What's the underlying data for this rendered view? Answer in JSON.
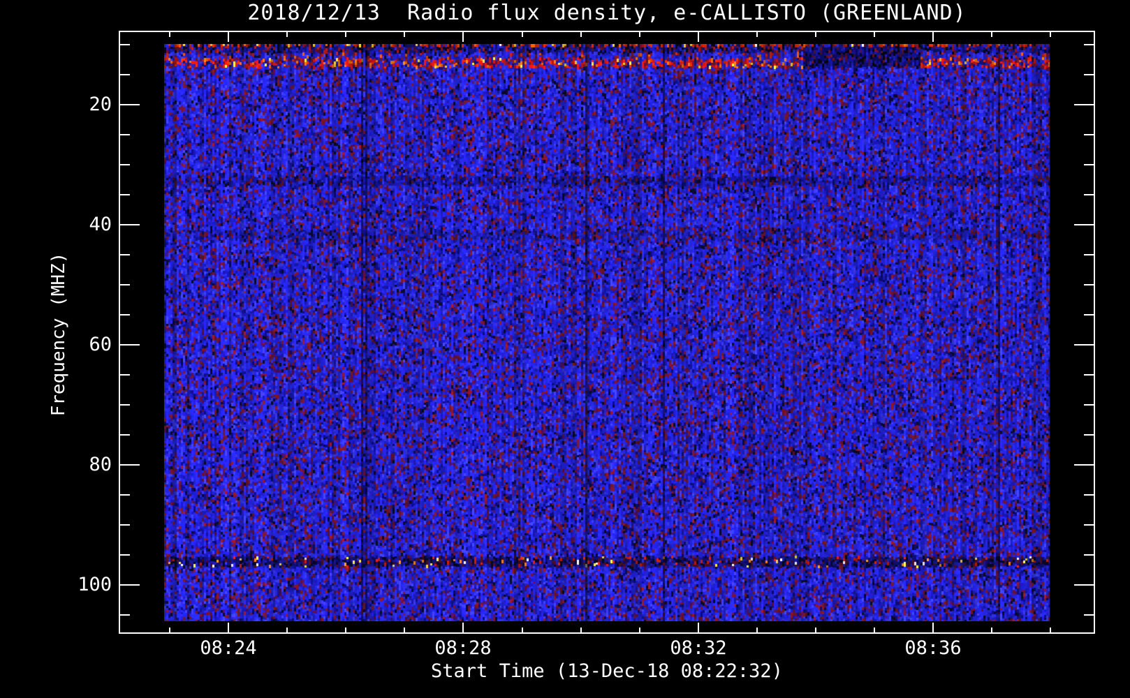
{
  "title": "2018/12/13  Radio flux density, e-CALLISTO (GREENLAND)",
  "x_axis": {
    "label": "Start Time (13-Dec-18 08:22:32)",
    "major_ticks": [
      {
        "label": "08:24",
        "offset_min": 0
      },
      {
        "label": "08:28",
        "offset_min": 4
      },
      {
        "label": "08:32",
        "offset_min": 8
      },
      {
        "label": "08:36",
        "offset_min": 12
      }
    ],
    "minor_tick_every_min": 1,
    "minor_range_min": [
      -1,
      14
    ]
  },
  "y_axis": {
    "label": "Frequency (MHZ)",
    "major_ticks": [
      20,
      40,
      60,
      80,
      100
    ],
    "minor_tick_every_mhz": 5,
    "minor_range_mhz": [
      10,
      105
    ]
  },
  "chart_data": {
    "type": "heatmap",
    "subtype": "radio-spectrogram",
    "title": "2018/12/13  Radio flux density, e-CALLISTO (GREENLAND)",
    "xlabel": "Start Time (13-Dec-18 08:22:32)",
    "ylabel": "Frequency (MHZ)",
    "station": "GREENLAND",
    "instrument": "e-CALLISTO",
    "date": "2018/12/13",
    "start_time": "08:22:32",
    "x_tick_labels": [
      "08:24",
      "08:28",
      "08:32",
      "08:36"
    ],
    "y_tick_labels": [
      20,
      40,
      60,
      80,
      100
    ],
    "freq_range_mhz": [
      9.9,
      106
    ],
    "background_character": "blue noise field with sparse dark-red speckles",
    "palettes": {
      "base": [
        [
          "#2626e8",
          30
        ],
        [
          "#1f1fd4",
          18
        ],
        [
          "#1616ad",
          10
        ],
        [
          "#0c0c7a",
          7
        ],
        [
          "#3b3bf0",
          12
        ],
        [
          "#6b1430",
          9
        ],
        [
          "#4a1166",
          5
        ],
        [
          "#8c1622",
          4
        ],
        [
          "#0a0a28",
          5
        ]
      ],
      "speckle": [
        [
          "#cc2200",
          22
        ],
        [
          "#ff5500",
          7
        ],
        [
          "#ffcc22",
          6
        ],
        [
          "#ffffff",
          1
        ],
        [
          "#2222cc",
          22
        ],
        [
          "#111166",
          18
        ],
        [
          "#060618",
          14
        ],
        [
          "#7a1020",
          10
        ]
      ],
      "darkrow": [
        [
          "#10107a",
          30
        ],
        [
          "#1b1bb8",
          22
        ],
        [
          "#060620",
          16
        ],
        [
          "#5a1028",
          14
        ],
        [
          "#a61818",
          10
        ],
        [
          "#2a2ad4",
          8
        ]
      ],
      "bluerow": [
        [
          "#2424dd",
          30
        ],
        [
          "#1a1ab8",
          20
        ],
        [
          "#3535ee",
          14
        ],
        [
          "#6b1430",
          12
        ],
        [
          "#b02010",
          8
        ],
        [
          "#0a0a30",
          10
        ],
        [
          "#e05510",
          3
        ],
        [
          "#12128c",
          3
        ]
      ],
      "burst": [
        [
          "#d41414",
          24
        ],
        [
          "#ff2a08",
          9
        ],
        [
          "#ff7712",
          8
        ],
        [
          "#ffe040",
          4
        ],
        [
          "#6b1430",
          16
        ],
        [
          "#2020c8",
          20
        ],
        [
          "#10107a",
          12
        ],
        [
          "#3333e8",
          7
        ]
      ],
      "dim": [
        [
          "#1b1bbd",
          28
        ],
        [
          "#14149a",
          20
        ],
        [
          "#0c0c6e",
          14
        ],
        [
          "#551026",
          12
        ],
        [
          "#2a2ad8",
          14
        ],
        [
          "#080824",
          8
        ],
        [
          "#741420",
          4
        ]
      ],
      "dim2": [
        [
          "#2020c8",
          28
        ],
        [
          "#1818a4",
          20
        ],
        [
          "#101080",
          12
        ],
        [
          "#5c1228",
          12
        ],
        [
          "#2e2edd",
          16
        ],
        [
          "#0a0a30",
          8
        ],
        [
          "#7a1424",
          4
        ]
      ],
      "fmband": [
        [
          "#0d0d6e",
          26
        ],
        [
          "#181894",
          20
        ],
        [
          "#060626",
          18
        ],
        [
          "#4a0e20",
          14
        ],
        [
          "#2222c4",
          10
        ],
        [
          "#cc1c10",
          6
        ],
        [
          "#ff8820",
          2
        ],
        [
          "#ffe24a",
          2
        ],
        [
          "#eeeeee",
          1
        ],
        [
          "#2e2ee0",
          1
        ]
      ],
      "patch": [
        [
          "#0b0b66",
          30
        ],
        [
          "#131390",
          22
        ],
        [
          "#050518",
          20
        ],
        [
          "#40103a",
          10
        ],
        [
          "#1c1cb4",
          12
        ],
        [
          "#6e1228",
          6
        ]
      ]
    },
    "bands": [
      {
        "name": "top-speckle-row",
        "f": [
          9.7,
          10.4
        ],
        "palette": "speckle"
      },
      {
        "name": "dark-interference",
        "f": [
          10.4,
          11.4
        ],
        "palette": "darkrow"
      },
      {
        "name": "blue-row",
        "f": [
          11.4,
          12.3
        ],
        "palette": "bluerow"
      },
      {
        "name": "burst-band",
        "f": [
          12.3,
          13.8
        ],
        "palette": "burst"
      },
      {
        "name": "dim-band-33mhz",
        "f": [
          31.9,
          33.5
        ],
        "palette": "dim"
      },
      {
        "name": "dim-band-41mhz",
        "f": [
          40.9,
          42.6
        ],
        "palette": "dim2"
      },
      {
        "name": "fm-band-96mhz",
        "f": [
          95.3,
          97.0
        ],
        "palette": "fmband"
      }
    ],
    "patches": [
      {
        "name": "quiet-dark-patch",
        "f": [
          10.3,
          13.8
        ],
        "t_min": [
          9.8,
          11.8
        ],
        "palette": "patch"
      }
    ]
  }
}
